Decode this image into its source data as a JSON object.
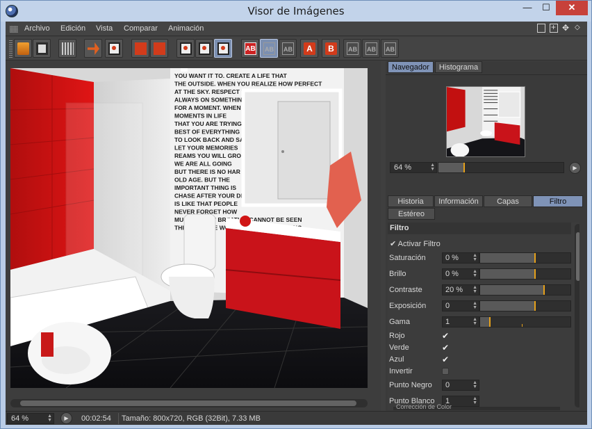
{
  "window": {
    "title": "Visor de Imágenes",
    "min_glyph": "—",
    "max_glyph": "☐",
    "close_glyph": "✕"
  },
  "menu": {
    "items": [
      "Archivo",
      "Edición",
      "Vista",
      "Comparar",
      "Animación"
    ]
  },
  "toolbar": {
    "buttons": [
      {
        "icon": "open-folder-icon"
      },
      {
        "icon": "save-icon"
      },
      {
        "icon": "grid-icon"
      },
      {
        "icon": "export-arrows-icon"
      },
      {
        "icon": "download-icon"
      },
      {
        "icon": "copy-icon"
      },
      {
        "icon": "paste-icon"
      },
      {
        "icon": "screen-a-icon"
      },
      {
        "icon": "screen-b-icon"
      },
      {
        "icon": "compare-icon"
      },
      {
        "icon": "ab-compare-icon"
      },
      {
        "icon": "ab-split-icon"
      },
      {
        "icon": "ab-swap-icon"
      },
      {
        "icon": "set-a-icon",
        "text": "A"
      },
      {
        "icon": "set-b-icon",
        "text": "B"
      },
      {
        "icon": "ab-dim-1-icon"
      },
      {
        "icon": "ab-dim-2-icon"
      },
      {
        "icon": "ab-dim-3-icon"
      }
    ]
  },
  "navigator": {
    "tabs": [
      "Navegador",
      "Histograma"
    ],
    "zoom": "64 %",
    "zoom_fraction": 0.2
  },
  "panel_tabs": {
    "row1": [
      "Historia",
      "Información",
      "Capas",
      "Filtro"
    ],
    "row2": [
      "Estéreo"
    ],
    "active": "Filtro"
  },
  "filter": {
    "section_title": "Filtro",
    "enable_label": "Activar Filtro",
    "enable_check": "✔",
    "properties": [
      {
        "label": "Saturación",
        "value": "0 %",
        "level": 0.6
      },
      {
        "label": "Brillo",
        "value": "0 %",
        "level": 0.6
      },
      {
        "label": "Contraste",
        "value": "20 %",
        "level": 0.7
      },
      {
        "label": "Exposición",
        "value": "0",
        "level": 0.6
      },
      {
        "label": "Gama",
        "value": "1",
        "level": 0.1
      }
    ],
    "channels": [
      {
        "label": "Rojo",
        "checked": true
      },
      {
        "label": "Verde",
        "checked": true
      },
      {
        "label": "Azul",
        "checked": true
      },
      {
        "label": "Invertir",
        "checked": false
      }
    ],
    "levels": [
      {
        "label": "Punto Negro",
        "value": "0"
      },
      {
        "label": "Punto Blanco",
        "value": "1"
      }
    ],
    "check_glyph": "✔",
    "subsection": "Corrección de Color"
  },
  "status": {
    "zoom": "64 %",
    "time": "00:02:54",
    "info": "Tamaño: 800x720, RGB (32Bit), 7.33 MB"
  },
  "image": {
    "lines": [
      "YOU WANT IT TO. CREATE A LIFE THAT",
      "THE OUTSIDE. WHEN YOU REALIZE HOW PERFECT",
      "AT THE SKY. RESPECT YOURSELF ENOUGH TO",
      "ALWAYS ON SOMETHING GREAT",
      "FOR A MOMENT. WHEN I SAW",
      "MOMENTS IN LIFE",
      "THAT YOU ARE TRYING",
      "BEST OF EVERYTHING",
      "TO LOOK BACK AND SAY",
      "LET YOUR MEMORIES",
      "REAMS YOU WILL GRO",
      "WE ARE ALL GOING",
      "BUT THERE IS NO HAR",
      "OLD AGE. BUT THE",
      "IMPORTANT THING IS",
      "CHASE AFTER YOUR DREAMS",
      "IS LIKE THAT PEOPLE",
      "NEVER FORGET HOW",
      "MUCH AS YOU BREATHE. CANNOT BE SEEN",
      "THINGS IN THE WORLD AND LOVE AS LONG"
    ]
  }
}
